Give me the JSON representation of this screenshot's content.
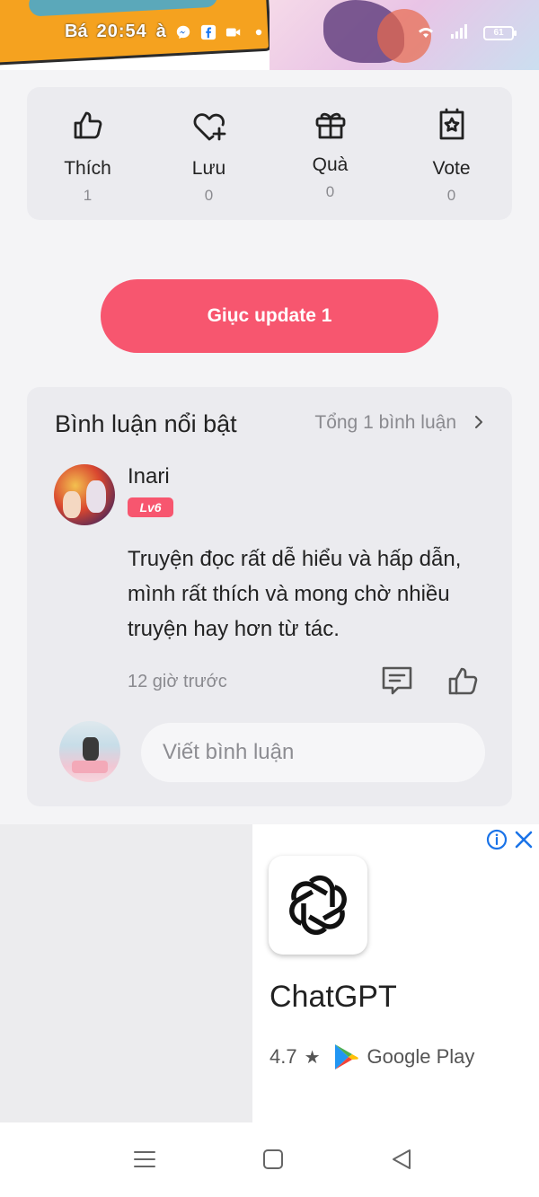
{
  "status_bar": {
    "banner_text": "Bá",
    "banner_text_suffix": "à",
    "time": "20:54",
    "battery": "61"
  },
  "reactions": [
    {
      "label": "Thích",
      "count": "1",
      "icon": "thumbs-up-icon"
    },
    {
      "label": "Lưu",
      "count": "0",
      "icon": "heart-plus-icon"
    },
    {
      "label": "Quà",
      "count": "0",
      "icon": "gift-icon"
    },
    {
      "label": "Vote",
      "count": "0",
      "icon": "vote-star-icon"
    }
  ],
  "update_button": "Giục update 1",
  "comments": {
    "title": "Bình luận nổi bật",
    "total": "Tổng 1 bình luận",
    "items": [
      {
        "user": "Inari",
        "level": "Lv6",
        "text": "Truyện đọc rất dễ hiểu và hấp dẫn, mình rất thích và mong chờ nhiều truyện hay hơn từ tác.",
        "time": "12 giờ trước"
      }
    ],
    "input_placeholder": "Viết bình luận"
  },
  "ad": {
    "app_name": "ChatGPT",
    "rating": "4.7",
    "store": "Google Play"
  },
  "colors": {
    "accent": "#f7566f",
    "card_bg": "#ebebef",
    "page_bg": "#f4f4f6"
  }
}
